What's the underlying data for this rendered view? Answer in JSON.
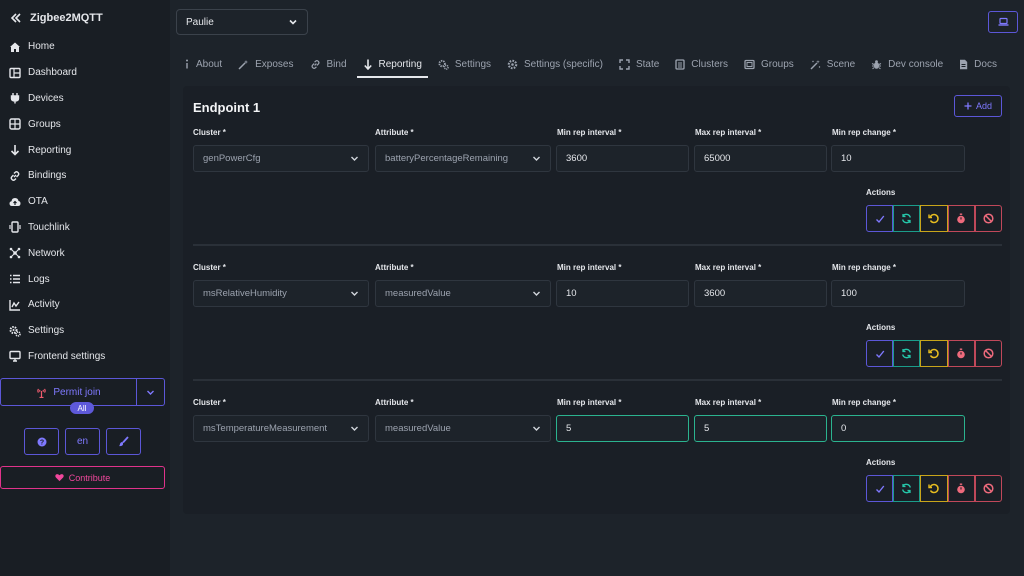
{
  "brand": {
    "title": "Zigbee2MQTT"
  },
  "sidebar": {
    "items": [
      {
        "label": "Home",
        "icon": "home-icon"
      },
      {
        "label": "Dashboard",
        "icon": "dashboard-icon"
      },
      {
        "label": "Devices",
        "icon": "plug-icon"
      },
      {
        "label": "Groups",
        "icon": "groups-icon"
      },
      {
        "label": "Reporting",
        "icon": "arrow-down-icon"
      },
      {
        "label": "Bindings",
        "icon": "link-icon"
      },
      {
        "label": "OTA",
        "icon": "cloud-upload-icon"
      },
      {
        "label": "Touchlink",
        "icon": "touchlink-icon"
      },
      {
        "label": "Network",
        "icon": "network-icon"
      },
      {
        "label": "Logs",
        "icon": "list-icon"
      },
      {
        "label": "Activity",
        "icon": "activity-icon"
      },
      {
        "label": "Settings",
        "icon": "cogs-icon"
      },
      {
        "label": "Frontend settings",
        "icon": "display-icon"
      }
    ],
    "permit_join": {
      "label": "Permit join",
      "badge": "All"
    },
    "language": "en",
    "contribute": "Contribute"
  },
  "header": {
    "device": "Paulie"
  },
  "tabs": [
    {
      "label": "About",
      "icon": "info-icon"
    },
    {
      "label": "Exposes",
      "icon": "wand-icon"
    },
    {
      "label": "Bind",
      "icon": "link-icon"
    },
    {
      "label": "Reporting",
      "icon": "arrow-down-icon",
      "active": true
    },
    {
      "label": "Settings",
      "icon": "cogs-icon"
    },
    {
      "label": "Settings (specific)",
      "icon": "cog-icon"
    },
    {
      "label": "State",
      "icon": "expand-icon"
    },
    {
      "label": "Clusters",
      "icon": "clusters-icon"
    },
    {
      "label": "Groups",
      "icon": "groups-icon"
    },
    {
      "label": "Scene",
      "icon": "scene-icon"
    },
    {
      "label": "Dev console",
      "icon": "bug-icon"
    },
    {
      "label": "Docs",
      "icon": "doc-icon"
    }
  ],
  "endpoint": {
    "title": "Endpoint 1",
    "add_label": "Add",
    "labels": {
      "cluster": "Cluster *",
      "attribute": "Attribute *",
      "min_interval": "Min rep interval *",
      "max_interval": "Max rep interval *",
      "min_change": "Min rep change *",
      "actions": "Actions"
    },
    "rules": [
      {
        "cluster": "genPowerCfg",
        "attribute": "batteryPercentageRemaining",
        "min_interval": "3600",
        "max_interval": "65000",
        "min_change": "10"
      },
      {
        "cluster": "msRelativeHumidity",
        "attribute": "measuredValue",
        "min_interval": "10",
        "max_interval": "3600",
        "min_change": "100"
      },
      {
        "cluster": "msTemperatureMeasurement",
        "attribute": "measuredValue",
        "min_interval": "5",
        "max_interval": "5",
        "min_change": "0"
      }
    ]
  },
  "colors": {
    "accent": "#7f79ff",
    "teal": "#25c7aa",
    "warning": "#e8be20",
    "danger": "#ee6a7c",
    "pink": "#f0479c"
  }
}
